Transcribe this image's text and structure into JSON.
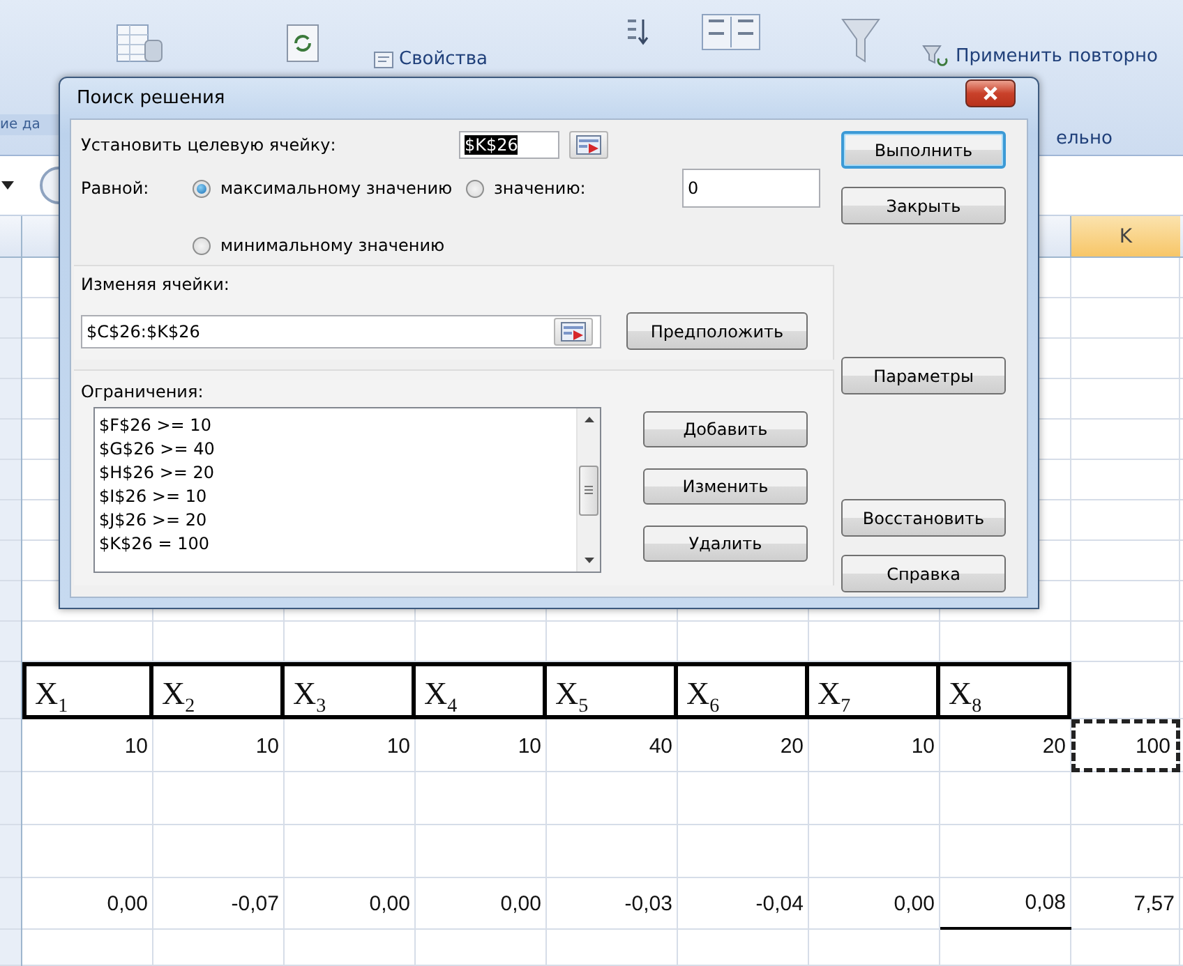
{
  "ribbon": {
    "group_label": "ие да",
    "commands": [
      {
        "label": "Свойства"
      },
      {
        "label": "Применить повторно"
      },
      {
        "label": "ельно"
      }
    ]
  },
  "sheet": {
    "column_header": {
      "label": "K",
      "selected": true
    },
    "labels_row": [
      "X$_{1}$",
      "X$_{2}$",
      "X$_{3}$",
      "X$_{4}$",
      "X$_{5}$",
      "X$_{6}$",
      "X$_{7}$",
      "X$_{8}$"
    ],
    "values_row": {
      "cells": [
        "10",
        "10",
        "10",
        "10",
        "40",
        "20",
        "10",
        "20"
      ],
      "total": "100",
      "total_copied": true
    },
    "results_row": {
      "cells": [
        "0,00",
        "-0,07",
        "0,00",
        "0,00",
        "-0,03",
        "-0,04",
        "0,00",
        "0,08"
      ],
      "total": "7,57"
    }
  },
  "dialog": {
    "title": "Поиск решения",
    "target": {
      "label": "Установить целевую ячейку:",
      "value": "$K$26",
      "highlighted": true
    },
    "equal_to": {
      "label": "Равной:",
      "options": [
        {
          "label": "максимальному значению",
          "selected": true
        },
        {
          "label": "значению:",
          "selected": false
        },
        {
          "label": "минимальному значению",
          "selected": false
        }
      ],
      "value": "0"
    },
    "changing": {
      "label": "Изменяя ячейки:",
      "value": "$C$26:$K$26",
      "button": "Предположить"
    },
    "constraints": {
      "label": "Ограничения:",
      "items": [
        "$F$26 >= 10",
        "$G$26 >= 40",
        "$H$26 >= 20",
        "$I$26 >= 10",
        "$J$26 >= 20",
        "$K$26 = 100"
      ],
      "buttons": [
        "Добавить",
        "Изменить",
        "Удалить"
      ]
    },
    "side_buttons": [
      {
        "label": "Выполнить",
        "default": true
      },
      {
        "label": "Закрыть",
        "default": false
      },
      {
        "label": "Параметры",
        "default": false
      },
      {
        "label": "Восстановить",
        "default": false
      },
      {
        "label": "Справка",
        "default": false
      }
    ]
  }
}
